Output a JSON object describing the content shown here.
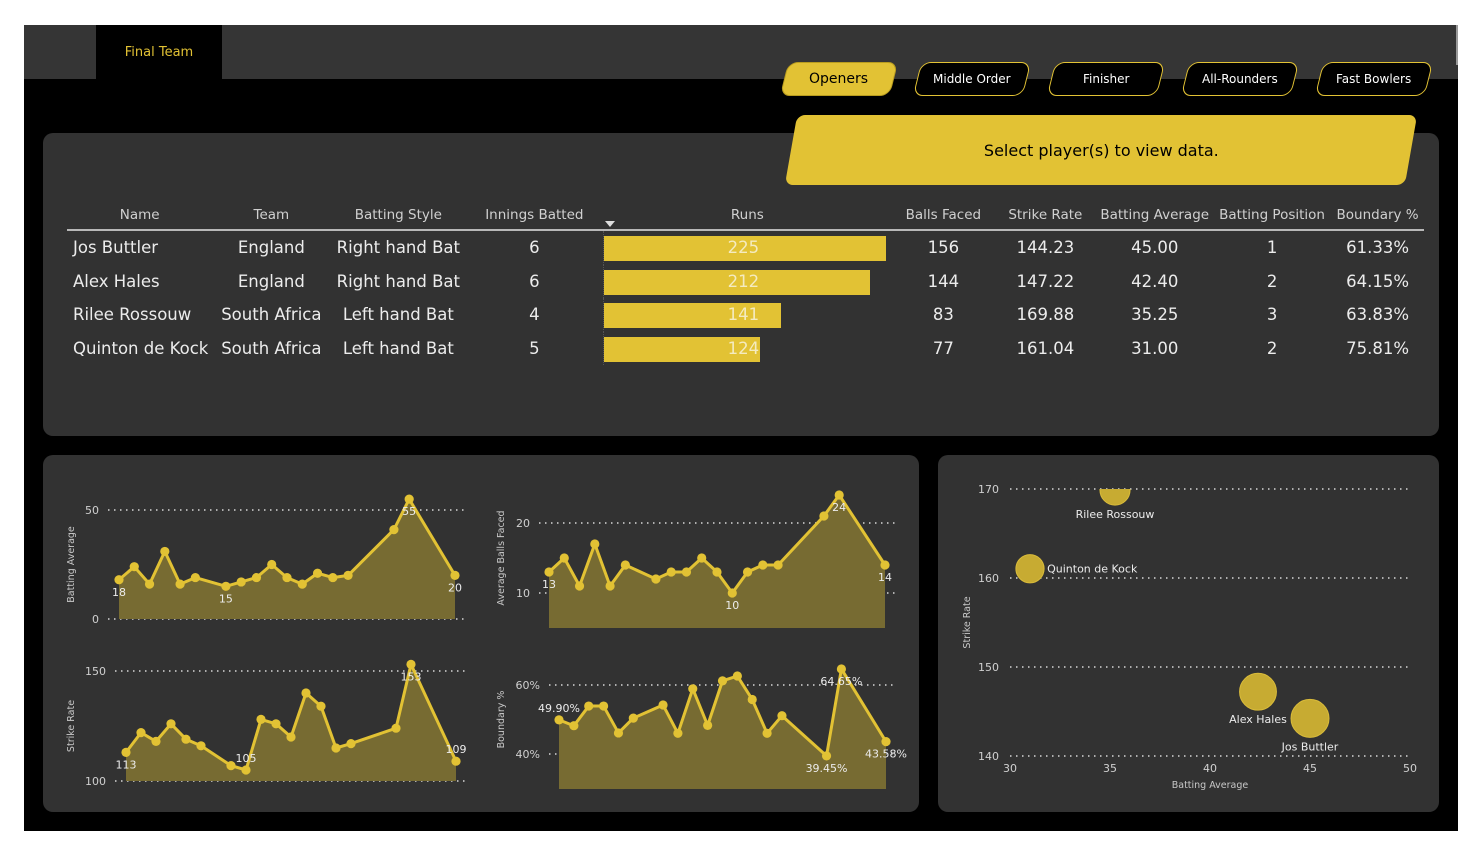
{
  "page": {
    "active_tab": "Final Team",
    "accent_color": "#e2c234",
    "background_color": "#000000",
    "panel_color": "#323232"
  },
  "nav_buttons": [
    {
      "label": "Openers",
      "active": true
    },
    {
      "label": "Middle Order",
      "active": false
    },
    {
      "label": "Finisher",
      "active": false
    },
    {
      "label": "All-Rounders",
      "active": false
    },
    {
      "label": "Fast Bowlers",
      "active": false
    }
  ],
  "banner": {
    "text": "Select player(s) to view data."
  },
  "table": {
    "headers": [
      "Name",
      "Team",
      "Batting Style",
      "Innings Batted",
      "Runs",
      "Balls Faced",
      "Strike Rate",
      "Batting Average",
      "Batting Position",
      "Boundary %"
    ],
    "sort_column": "Runs",
    "sort_direction": "descending",
    "runs_max": 225,
    "rows": [
      {
        "name": "Jos Buttler",
        "team": "England",
        "style": "Right hand Bat",
        "innings": "6",
        "runs": 225,
        "balls": "156",
        "sr": "144.23",
        "avg": "45.00",
        "pos": "1",
        "boundary": "61.33%"
      },
      {
        "name": "Alex Hales",
        "team": "England",
        "style": "Right hand Bat",
        "innings": "6",
        "runs": 212,
        "balls": "144",
        "sr": "147.22",
        "avg": "42.40",
        "pos": "2",
        "boundary": "64.15%"
      },
      {
        "name": "Rilee Rossouw",
        "team": "South Africa",
        "style": "Left hand Bat",
        "innings": "4",
        "runs": 141,
        "balls": "83",
        "sr": "169.88",
        "avg": "35.25",
        "pos": "3",
        "boundary": "63.83%"
      },
      {
        "name": "Quinton de Kock",
        "team": "South Africa",
        "style": "Left hand Bat",
        "innings": "5",
        "runs": 124,
        "balls": "77",
        "sr": "161.04",
        "avg": "31.00",
        "pos": "2",
        "boundary": "75.81%"
      }
    ]
  },
  "chart_data": [
    {
      "type": "area",
      "title": "",
      "ylabel": "Batting Average",
      "yticks": [
        "0",
        "50"
      ],
      "ytick_values": [
        0,
        50
      ],
      "ylim": [
        0,
        50
      ],
      "x_index": [
        0,
        1,
        2,
        3,
        4,
        5,
        7,
        8,
        9,
        10,
        11,
        12,
        13,
        14,
        15,
        18,
        19,
        22
      ],
      "values": [
        18,
        24,
        16,
        31,
        16,
        19,
        15,
        17,
        19,
        25,
        19,
        16,
        21,
        19,
        20,
        41,
        55,
        20
      ],
      "labels": [
        {
          "i": 0,
          "text": "18",
          "pos": "below"
        },
        {
          "i": 6,
          "text": "15",
          "pos": "below"
        },
        {
          "i": 16,
          "text": "55",
          "pos": "below"
        },
        {
          "i": 17,
          "text": "20",
          "pos": "below"
        }
      ]
    },
    {
      "type": "area",
      "title": "",
      "ylabel": "Average Balls Faced",
      "yticks": [
        "10",
        "20"
      ],
      "ytick_values": [
        10,
        20
      ],
      "ylim": [
        5,
        20
      ],
      "x_index": [
        0,
        1,
        2,
        3,
        4,
        5,
        7,
        8,
        9,
        10,
        11,
        12,
        13,
        14,
        15,
        18,
        19,
        22
      ],
      "values": [
        13,
        15,
        11,
        17,
        11,
        14,
        12,
        13,
        13,
        15,
        13,
        10,
        13,
        14,
        14,
        21,
        24,
        14
      ],
      "labels": [
        {
          "i": 0,
          "text": "13",
          "pos": "below"
        },
        {
          "i": 11,
          "text": "10",
          "pos": "below"
        },
        {
          "i": 16,
          "text": "24",
          "pos": "below"
        },
        {
          "i": 17,
          "text": "14",
          "pos": "below"
        }
      ]
    },
    {
      "type": "area",
      "title": "",
      "ylabel": "Strike Rate",
      "yticks": [
        "100",
        "150"
      ],
      "ytick_values": [
        100,
        150
      ],
      "ylim": [
        100,
        150
      ],
      "x_index": [
        0,
        1,
        2,
        3,
        4,
        5,
        7,
        8,
        9,
        10,
        11,
        12,
        13,
        14,
        15,
        18,
        19,
        22
      ],
      "values": [
        113,
        122,
        118,
        126,
        119,
        116,
        107,
        105,
        128,
        126,
        120,
        140,
        134,
        115,
        117,
        124,
        153,
        109
      ],
      "labels": [
        {
          "i": 0,
          "text": "113",
          "pos": "below"
        },
        {
          "i": 7,
          "text": "105",
          "pos": "above"
        },
        {
          "i": 16,
          "text": "153",
          "pos": "below"
        },
        {
          "i": 17,
          "text": "109",
          "pos": "above"
        }
      ]
    },
    {
      "type": "area",
      "title": "",
      "ylabel": "Boundary %",
      "yticks": [
        "40%",
        "60%"
      ],
      "ytick_values": [
        40,
        60
      ],
      "ylim": [
        30,
        60
      ],
      "x_index": [
        0,
        1,
        2,
        3,
        4,
        5,
        7,
        8,
        9,
        10,
        11,
        12,
        13,
        14,
        15,
        18,
        19,
        22
      ],
      "values": [
        49.9,
        48.2,
        53.9,
        53.9,
        46.1,
        50.4,
        54.2,
        46.0,
        58.9,
        48.3,
        61.2,
        62.6,
        55.8,
        46.0,
        51.1,
        39.45,
        64.65,
        43.58
      ],
      "labels": [
        {
          "i": 0,
          "text": "49.90%",
          "pos": "above"
        },
        {
          "i": 15,
          "text": "39.45%",
          "pos": "below"
        },
        {
          "i": 16,
          "text": "64.65%",
          "pos": "below"
        },
        {
          "i": 17,
          "text": "43.58%",
          "pos": "below"
        }
      ]
    },
    {
      "type": "scatter",
      "title": "",
      "xlabel": "Batting Average",
      "ylabel": "Strike Rate",
      "xlim": [
        30,
        50
      ],
      "ylim": [
        140,
        170
      ],
      "xticks": [
        "30",
        "35",
        "40",
        "45",
        "50"
      ],
      "xtick_values": [
        30,
        35,
        40,
        45,
        50
      ],
      "yticks": [
        "140",
        "150",
        "160",
        "170"
      ],
      "ytick_values": [
        140,
        150,
        160,
        170
      ],
      "size_measure": "Runs",
      "points": [
        {
          "label": "Rilee Rossouw",
          "x": 35.25,
          "y": 169.88,
          "size": 141,
          "label_pos": "below"
        },
        {
          "label": "Quinton de Kock",
          "x": 31.0,
          "y": 161.04,
          "size": 124,
          "label_pos": "right"
        },
        {
          "label": "Alex Hales",
          "x": 42.4,
          "y": 147.22,
          "size": 212,
          "label_pos": "below"
        },
        {
          "label": "Jos Buttler",
          "x": 45.0,
          "y": 144.23,
          "size": 225,
          "label_pos": "below"
        }
      ]
    }
  ]
}
